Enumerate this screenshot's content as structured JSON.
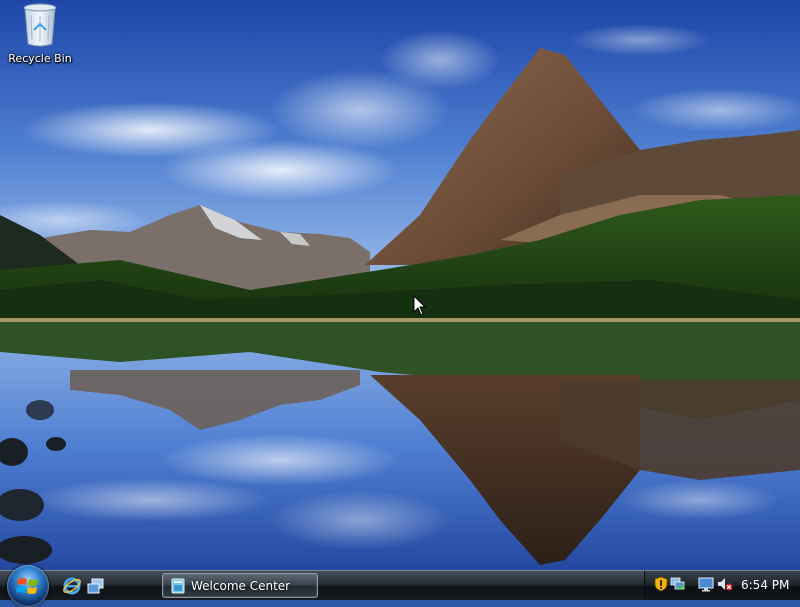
{
  "desktop": {
    "icons": [
      {
        "label": "Recycle Bin",
        "icon": "recycle-bin-icon"
      }
    ]
  },
  "taskbar": {
    "start_button": {
      "icon": "windows-logo-icon"
    },
    "quick_launch": [
      {
        "icon": "internet-explorer-icon"
      },
      {
        "icon": "switch-windows-icon"
      }
    ],
    "task_buttons": [
      {
        "label": "Welcome Center",
        "icon": "welcome-center-icon",
        "active": false
      }
    ],
    "tray": {
      "icons": [
        "windows-security-alert-icon",
        "network-icon",
        "display-icon",
        "volume-muted-icon"
      ],
      "clock": "6:54 PM"
    }
  },
  "colors": {
    "taskbar_bg": "#1b2128",
    "start_orb": "#2f7fd0",
    "security_shield": "#f2b20a",
    "volume_muted": "#d22020"
  }
}
